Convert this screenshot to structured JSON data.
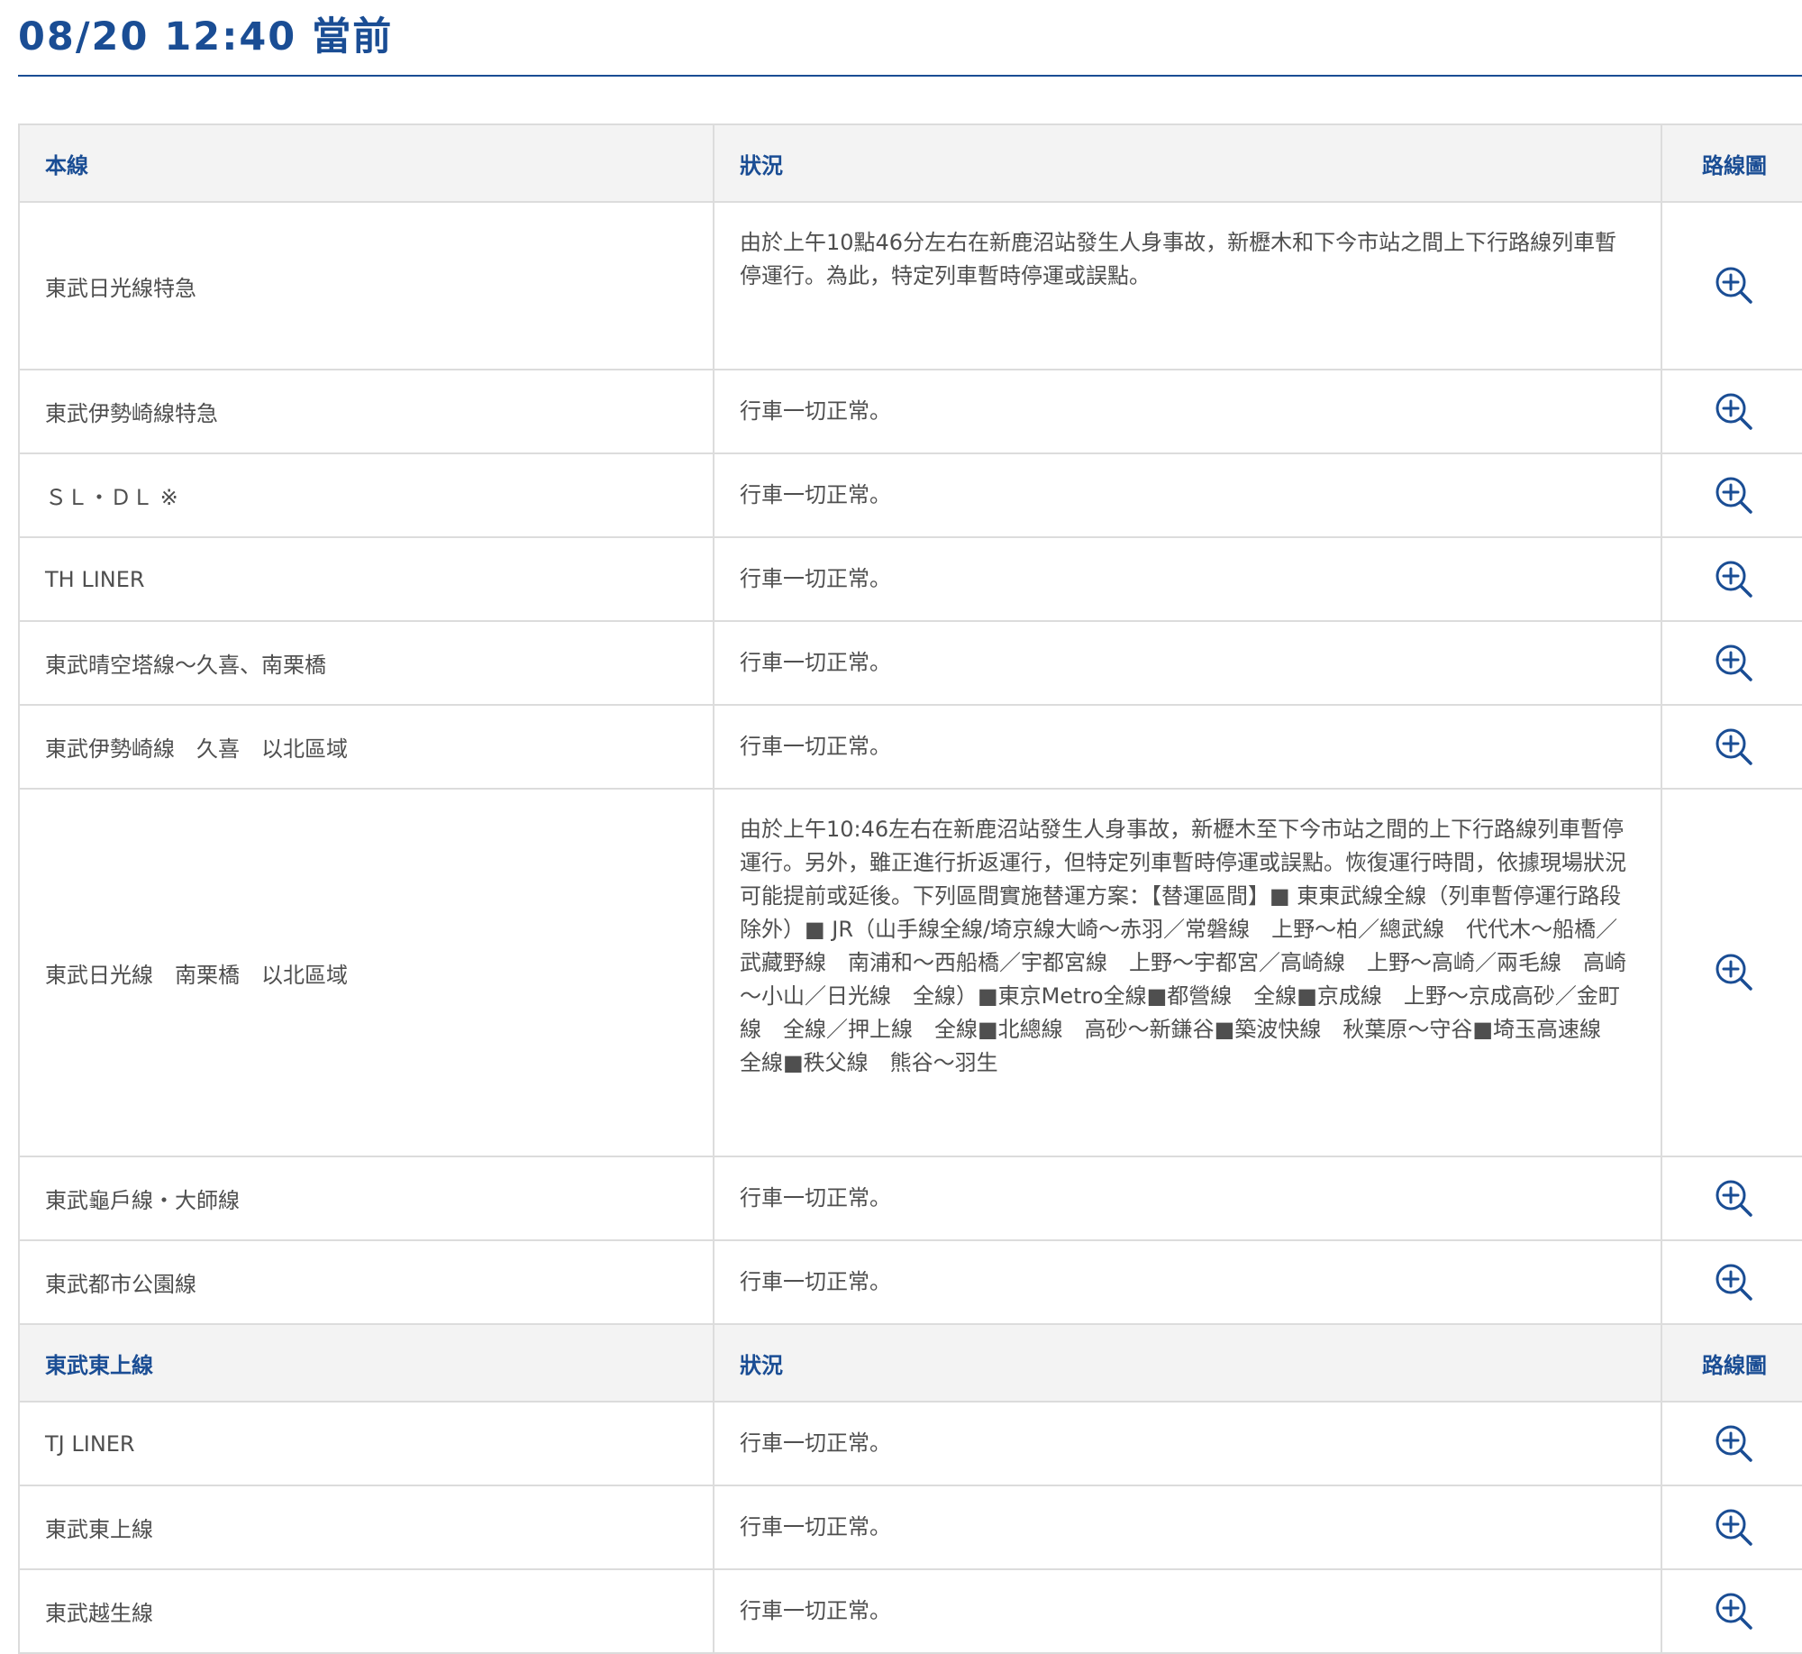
{
  "page": {
    "title": "08/20 12:40 當前"
  },
  "section_main": {
    "col_line": "本線",
    "col_status": "狀況",
    "col_map": "路線圖",
    "rows": [
      {
        "line": "東武日光線特急",
        "status": "由於上午10點46分左右在新鹿沼站發生人身事故，新櫪木和下今市站之間上下行路線列車暫停運行。為此，特定列車暫時停運或誤點。"
      },
      {
        "line": "東武伊勢崎線特急",
        "status": "行車一切正常。"
      },
      {
        "line": "ＳＬ・ＤＬ ※",
        "status": "行車一切正常。"
      },
      {
        "line": "TH LINER",
        "status": "行車一切正常。"
      },
      {
        "line": "東武晴空塔線～久喜、南栗橋",
        "status": "行車一切正常。"
      },
      {
        "line": "東武伊勢崎線　久喜　以北區域",
        "status": "行車一切正常。"
      },
      {
        "line": "東武日光線　南栗橋　以北區域",
        "status": "由於上午10:46左右在新鹿沼站發生人身事故，新櫪木至下今市站之間的上下行路線列車暫停運行。另外，雖正進行折返運行，但特定列車暫時停運或誤點。恢復運行時間，依據現場狀況可能提前或延後。下列區間實施替運方案：【替運區間】■ 東東武線全線（列車暫停運行路段除外）■ JR（山手線全線/埼京線大崎～赤羽／常磐線　上野～柏／總武線　代代木～船橋／武藏野線　南浦和～西船橋／宇都宮線　上野～宇都宮／高崎線　上野～高崎／兩毛線　高崎～小山／日光線　全線）■東京Metro全線■都營線　全線■京成線　上野～京成高砂／金町線　全線／押上線　全線■北總線　高砂～新鎌谷■築波快線　秋葉原～守谷■埼玉高速線　全線■秩父線　熊谷～羽生"
      },
      {
        "line": "東武龜戶線・大師線",
        "status": "行車一切正常。"
      },
      {
        "line": "東武都市公園線",
        "status": "行車一切正常。"
      }
    ]
  },
  "section_tojo": {
    "col_line": "東武東上線",
    "col_status": "狀況",
    "col_map": "路線圖",
    "rows": [
      {
        "line": "TJ LINER",
        "status": "行車一切正常。"
      },
      {
        "line": "東武東上線",
        "status": "行車一切正常。"
      },
      {
        "line": "東武越生線",
        "status": "行車一切正常。"
      }
    ]
  },
  "icons": {
    "map_button": "zoom-in-icon"
  },
  "colors": {
    "accent": "#1a4d94",
    "header_bg": "#f3f3f3",
    "border": "#dcdcdc"
  }
}
